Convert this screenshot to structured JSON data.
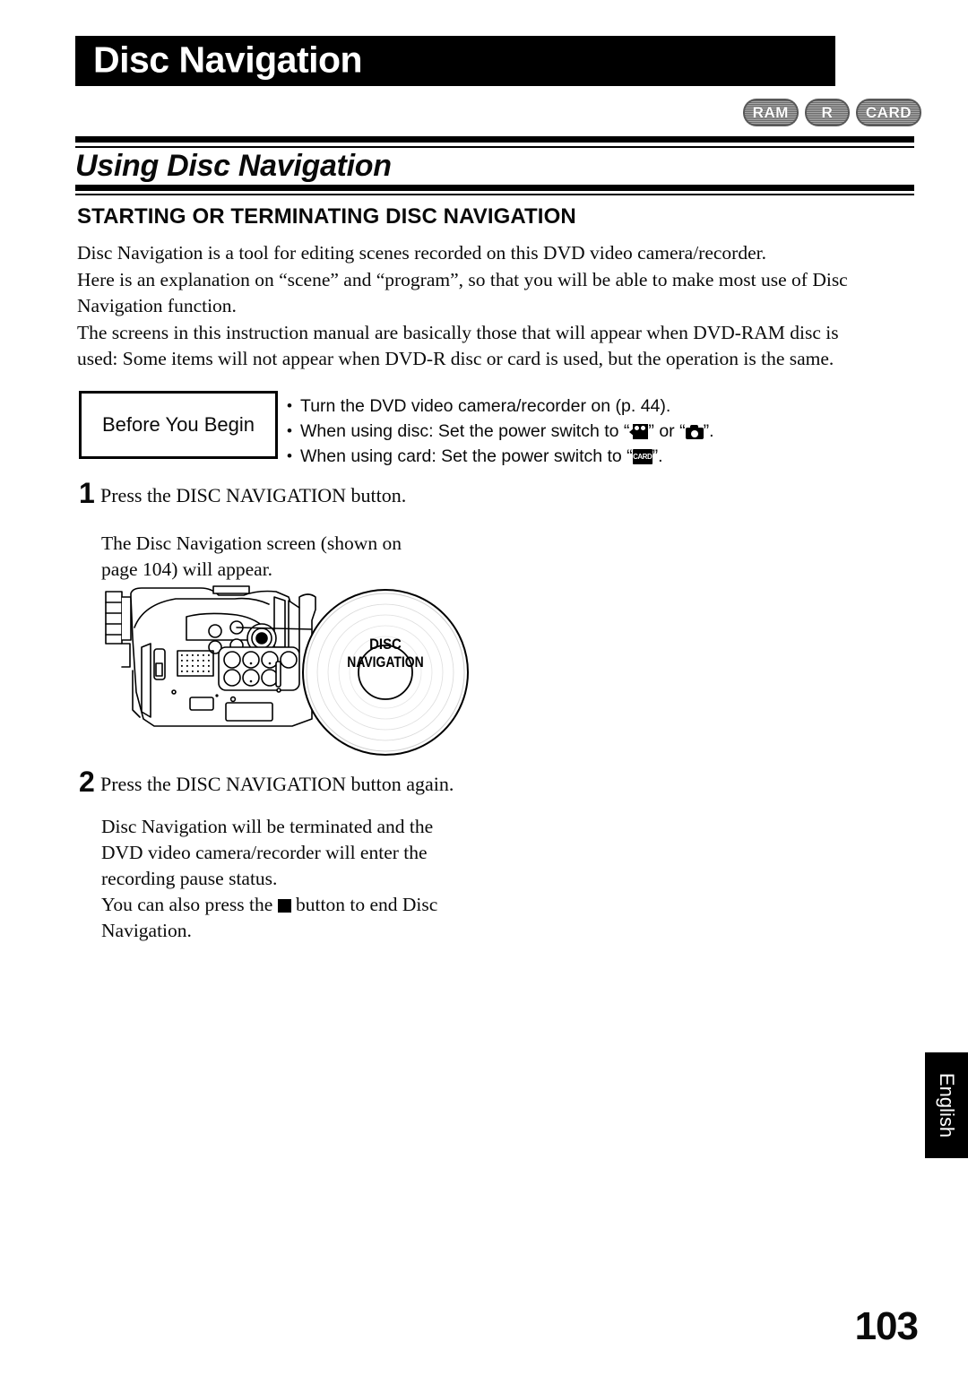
{
  "chapter": {
    "title": "Disc Navigation"
  },
  "media_badges": [
    {
      "label": "RAM",
      "name": "badge-ram"
    },
    {
      "label": "R",
      "name": "badge-r"
    },
    {
      "label": "CARD",
      "name": "badge-card"
    }
  ],
  "section": {
    "title": "Using Disc Navigation",
    "sub_heading": "STARTING OR TERMINATING DISC NAVIGATION"
  },
  "intro": {
    "line1": "Disc Navigation is a tool for editing scenes recorded on this DVD video camera/recorder.",
    "line2": "Here is an explanation on “scene” and “program”, so that you will be able to make most use of Disc",
    "line3": "Navigation function.",
    "line4": "The screens in this instruction manual are basically those that will appear when DVD-RAM disc is",
    "line5": "used: Some items will not appear when DVD-R disc or card is used, but the operation is the same."
  },
  "before_you_begin": {
    "label": "Before You Begin",
    "bullet_char": "•",
    "items": [
      {
        "prefix": "Turn the DVD video camera/recorder on (p. 44).",
        "icon": "",
        "middle": "",
        "icon2": "",
        "suffix": ""
      },
      {
        "prefix": "When using disc: Set the power switch to “",
        "icon": "movie-camera-icon",
        "middle": "” or “",
        "icon2": "still-camera-icon",
        "suffix": "”."
      },
      {
        "prefix": "When using card: Set the power switch to “",
        "icon": "card-icon",
        "middle": "",
        "icon2": "",
        "suffix": "”."
      }
    ],
    "card_glyph_text": "CARD"
  },
  "steps": [
    {
      "number": "1",
      "heading": "Press the DISC NAVIGATION button.",
      "body_line1": "The Disc Navigation screen (shown on",
      "body_line2": "page 104) will appear."
    },
    {
      "number": "2",
      "heading": "Press the DISC NAVIGATION button again.",
      "body_line1": "Disc Navigation will be terminated and the",
      "body_line2": "DVD video camera/recorder will enter the",
      "body_line3": "recording pause status.",
      "body_line4_a": "You can also press the ",
      "body_line4_icon": "stop-button-icon",
      "body_line4_b": " button to end Disc",
      "body_line5": "Navigation."
    }
  ],
  "illustration": {
    "alt": "DVD video camera/recorder with disc labeled DISC NAVIGATION",
    "disc_label_line1": "DISC",
    "disc_label_line2": "NAVIGATION"
  },
  "footer": {
    "language_tab": "English",
    "page_number": "103"
  },
  "colors": {
    "ink": "#000000",
    "paper": "#ffffff",
    "badge_gray": "#8d8d8d"
  }
}
